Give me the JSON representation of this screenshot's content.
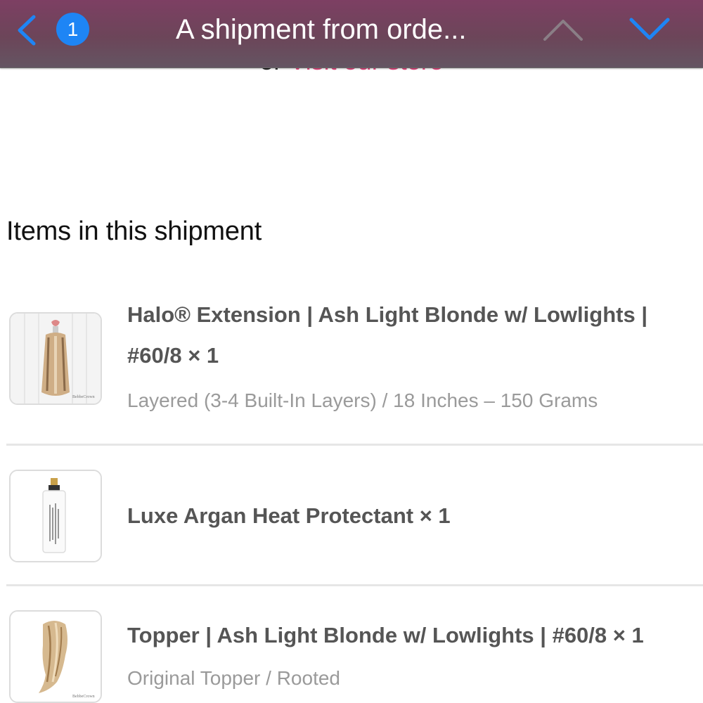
{
  "nav": {
    "unread_count": "1",
    "title": "A shipment from orde...",
    "icons": {
      "back": "chevron-left-icon",
      "previous": "chevron-up-icon",
      "next": "chevron-down-icon"
    },
    "accent_color": "#1e85f5"
  },
  "email": {
    "store_link_prefix": "or",
    "store_link_text": "Visit our store",
    "section_title": "Items in this shipment",
    "items": [
      {
        "title": "Halo® Extension | Ash Light Blonde w/ Lowlights | #60/8 × 1",
        "variant": "Layered (3-4 Built-In Layers) / 18 Inches – 150 Grams"
      },
      {
        "title": "Luxe Argan Heat Protectant × 1",
        "variant": ""
      },
      {
        "title": "Topper | Ash Light Blonde w/ Lowlights | #60/8 × 1",
        "variant": "Original Topper / Rooted"
      }
    ],
    "link_color": "#e2457d"
  }
}
